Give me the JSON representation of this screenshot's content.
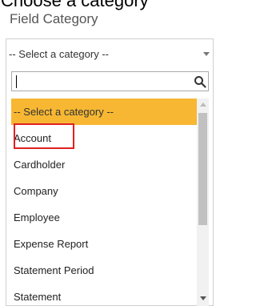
{
  "page_heading_cut": "Choose a category",
  "field_label": "Field Category",
  "select": {
    "value": "-- Select a category --"
  },
  "search": {
    "value": ""
  },
  "options": [
    "-- Select a category --",
    "Account",
    "Cardholder",
    "Company",
    "Employee",
    "Expense Report",
    "Statement Period",
    "Statement"
  ],
  "selected_index": 0,
  "highlighted_index": 1,
  "colors": {
    "selected_option_bg": "#f7b733",
    "highlight_border": "#e02020"
  },
  "icons": {
    "search": "search-icon",
    "dropdown": "chevron-down-icon",
    "scroll_up": "scroll-up-arrow-icon",
    "scroll_down": "scroll-down-arrow-icon"
  }
}
